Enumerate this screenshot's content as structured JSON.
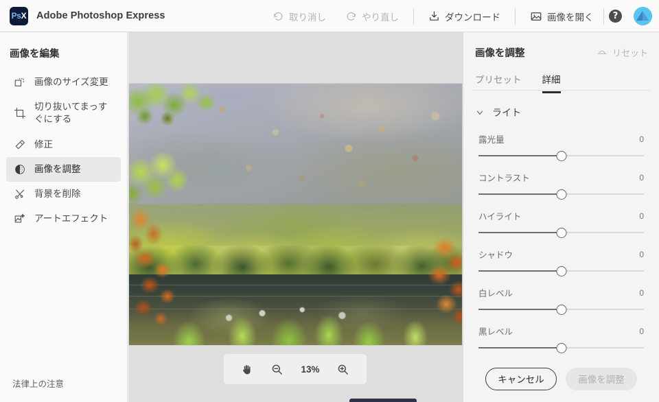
{
  "app": {
    "logo_text_ps": "Ps",
    "logo_text_x": "X",
    "title": "Adobe Photoshop Express"
  },
  "toolbar": {
    "undo_label": "取り消し",
    "redo_label": "やり直し",
    "download_label": "ダウンロード",
    "open_image_label": "画像を開く",
    "help_glyph": "?"
  },
  "sidebar": {
    "title": "画像を編集",
    "items": [
      {
        "label": "画像のサイズ変更",
        "icon": "resize-icon",
        "active": false
      },
      {
        "label": "切り抜いてまっすぐにする",
        "icon": "crop-icon",
        "active": false
      },
      {
        "label": "修正",
        "icon": "heal-icon",
        "active": false
      },
      {
        "label": "画像を調整",
        "icon": "adjust-icon",
        "active": true
      },
      {
        "label": "背景を削除",
        "icon": "scissors-icon",
        "active": false
      },
      {
        "label": "アートエフェクト",
        "icon": "art-effect-icon",
        "active": false
      }
    ],
    "legal_label": "法律上の注意"
  },
  "canvas": {
    "zoom_level": "13%",
    "hand_tool": "hand-icon",
    "zoom_out": "zoom-out-icon",
    "zoom_in": "zoom-in-icon",
    "photo_description": "秋の紅葉の山と湖"
  },
  "right_panel": {
    "title": "画像を調整",
    "reset_label": "リセット",
    "tabs": [
      {
        "label": "プリセット",
        "active": false
      },
      {
        "label": "詳細",
        "active": true
      }
    ],
    "sections": [
      {
        "name": "ライト",
        "expanded": true,
        "sliders": [
          {
            "label": "露光量",
            "value": "0",
            "position": 50
          },
          {
            "label": "コントラスト",
            "value": "0",
            "position": 50
          },
          {
            "label": "ハイライト",
            "value": "0",
            "position": 50
          },
          {
            "label": "シャドウ",
            "value": "0",
            "position": 50
          },
          {
            "label": "白レベル",
            "value": "0",
            "position": 50
          },
          {
            "label": "黒レベル",
            "value": "0",
            "position": 50
          }
        ]
      }
    ],
    "cancel_label": "キャンセル",
    "apply_label": "画像を調整"
  },
  "colors": {
    "accent": "#58c4f0",
    "logo_bg": "#0d1a38",
    "canvas_bg": "#dedede",
    "panel_bg": "#f4f4f4",
    "active_item_bg": "#e8e8e8"
  }
}
